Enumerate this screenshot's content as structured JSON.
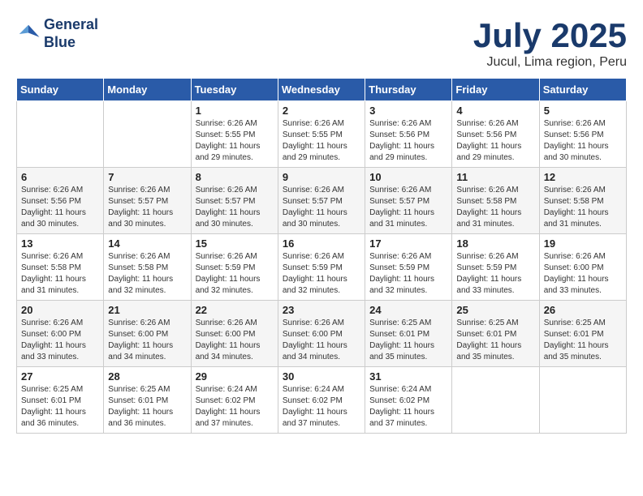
{
  "header": {
    "logo_line1": "General",
    "logo_line2": "Blue",
    "month": "July 2025",
    "location": "Jucul, Lima region, Peru"
  },
  "weekdays": [
    "Sunday",
    "Monday",
    "Tuesday",
    "Wednesday",
    "Thursday",
    "Friday",
    "Saturday"
  ],
  "weeks": [
    [
      {
        "day": "",
        "sunrise": "",
        "sunset": "",
        "daylight": ""
      },
      {
        "day": "",
        "sunrise": "",
        "sunset": "",
        "daylight": ""
      },
      {
        "day": "1",
        "sunrise": "Sunrise: 6:26 AM",
        "sunset": "Sunset: 5:55 PM",
        "daylight": "Daylight: 11 hours and 29 minutes."
      },
      {
        "day": "2",
        "sunrise": "Sunrise: 6:26 AM",
        "sunset": "Sunset: 5:55 PM",
        "daylight": "Daylight: 11 hours and 29 minutes."
      },
      {
        "day": "3",
        "sunrise": "Sunrise: 6:26 AM",
        "sunset": "Sunset: 5:56 PM",
        "daylight": "Daylight: 11 hours and 29 minutes."
      },
      {
        "day": "4",
        "sunrise": "Sunrise: 6:26 AM",
        "sunset": "Sunset: 5:56 PM",
        "daylight": "Daylight: 11 hours and 29 minutes."
      },
      {
        "day": "5",
        "sunrise": "Sunrise: 6:26 AM",
        "sunset": "Sunset: 5:56 PM",
        "daylight": "Daylight: 11 hours and 30 minutes."
      }
    ],
    [
      {
        "day": "6",
        "sunrise": "Sunrise: 6:26 AM",
        "sunset": "Sunset: 5:56 PM",
        "daylight": "Daylight: 11 hours and 30 minutes."
      },
      {
        "day": "7",
        "sunrise": "Sunrise: 6:26 AM",
        "sunset": "Sunset: 5:57 PM",
        "daylight": "Daylight: 11 hours and 30 minutes."
      },
      {
        "day": "8",
        "sunrise": "Sunrise: 6:26 AM",
        "sunset": "Sunset: 5:57 PM",
        "daylight": "Daylight: 11 hours and 30 minutes."
      },
      {
        "day": "9",
        "sunrise": "Sunrise: 6:26 AM",
        "sunset": "Sunset: 5:57 PM",
        "daylight": "Daylight: 11 hours and 30 minutes."
      },
      {
        "day": "10",
        "sunrise": "Sunrise: 6:26 AM",
        "sunset": "Sunset: 5:57 PM",
        "daylight": "Daylight: 11 hours and 31 minutes."
      },
      {
        "day": "11",
        "sunrise": "Sunrise: 6:26 AM",
        "sunset": "Sunset: 5:58 PM",
        "daylight": "Daylight: 11 hours and 31 minutes."
      },
      {
        "day": "12",
        "sunrise": "Sunrise: 6:26 AM",
        "sunset": "Sunset: 5:58 PM",
        "daylight": "Daylight: 11 hours and 31 minutes."
      }
    ],
    [
      {
        "day": "13",
        "sunrise": "Sunrise: 6:26 AM",
        "sunset": "Sunset: 5:58 PM",
        "daylight": "Daylight: 11 hours and 31 minutes."
      },
      {
        "day": "14",
        "sunrise": "Sunrise: 6:26 AM",
        "sunset": "Sunset: 5:58 PM",
        "daylight": "Daylight: 11 hours and 32 minutes."
      },
      {
        "day": "15",
        "sunrise": "Sunrise: 6:26 AM",
        "sunset": "Sunset: 5:59 PM",
        "daylight": "Daylight: 11 hours and 32 minutes."
      },
      {
        "day": "16",
        "sunrise": "Sunrise: 6:26 AM",
        "sunset": "Sunset: 5:59 PM",
        "daylight": "Daylight: 11 hours and 32 minutes."
      },
      {
        "day": "17",
        "sunrise": "Sunrise: 6:26 AM",
        "sunset": "Sunset: 5:59 PM",
        "daylight": "Daylight: 11 hours and 32 minutes."
      },
      {
        "day": "18",
        "sunrise": "Sunrise: 6:26 AM",
        "sunset": "Sunset: 5:59 PM",
        "daylight": "Daylight: 11 hours and 33 minutes."
      },
      {
        "day": "19",
        "sunrise": "Sunrise: 6:26 AM",
        "sunset": "Sunset: 6:00 PM",
        "daylight": "Daylight: 11 hours and 33 minutes."
      }
    ],
    [
      {
        "day": "20",
        "sunrise": "Sunrise: 6:26 AM",
        "sunset": "Sunset: 6:00 PM",
        "daylight": "Daylight: 11 hours and 33 minutes."
      },
      {
        "day": "21",
        "sunrise": "Sunrise: 6:26 AM",
        "sunset": "Sunset: 6:00 PM",
        "daylight": "Daylight: 11 hours and 34 minutes."
      },
      {
        "day": "22",
        "sunrise": "Sunrise: 6:26 AM",
        "sunset": "Sunset: 6:00 PM",
        "daylight": "Daylight: 11 hours and 34 minutes."
      },
      {
        "day": "23",
        "sunrise": "Sunrise: 6:26 AM",
        "sunset": "Sunset: 6:00 PM",
        "daylight": "Daylight: 11 hours and 34 minutes."
      },
      {
        "day": "24",
        "sunrise": "Sunrise: 6:25 AM",
        "sunset": "Sunset: 6:01 PM",
        "daylight": "Daylight: 11 hours and 35 minutes."
      },
      {
        "day": "25",
        "sunrise": "Sunrise: 6:25 AM",
        "sunset": "Sunset: 6:01 PM",
        "daylight": "Daylight: 11 hours and 35 minutes."
      },
      {
        "day": "26",
        "sunrise": "Sunrise: 6:25 AM",
        "sunset": "Sunset: 6:01 PM",
        "daylight": "Daylight: 11 hours and 35 minutes."
      }
    ],
    [
      {
        "day": "27",
        "sunrise": "Sunrise: 6:25 AM",
        "sunset": "Sunset: 6:01 PM",
        "daylight": "Daylight: 11 hours and 36 minutes."
      },
      {
        "day": "28",
        "sunrise": "Sunrise: 6:25 AM",
        "sunset": "Sunset: 6:01 PM",
        "daylight": "Daylight: 11 hours and 36 minutes."
      },
      {
        "day": "29",
        "sunrise": "Sunrise: 6:24 AM",
        "sunset": "Sunset: 6:02 PM",
        "daylight": "Daylight: 11 hours and 37 minutes."
      },
      {
        "day": "30",
        "sunrise": "Sunrise: 6:24 AM",
        "sunset": "Sunset: 6:02 PM",
        "daylight": "Daylight: 11 hours and 37 minutes."
      },
      {
        "day": "31",
        "sunrise": "Sunrise: 6:24 AM",
        "sunset": "Sunset: 6:02 PM",
        "daylight": "Daylight: 11 hours and 37 minutes."
      },
      {
        "day": "",
        "sunrise": "",
        "sunset": "",
        "daylight": ""
      },
      {
        "day": "",
        "sunrise": "",
        "sunset": "",
        "daylight": ""
      }
    ]
  ]
}
